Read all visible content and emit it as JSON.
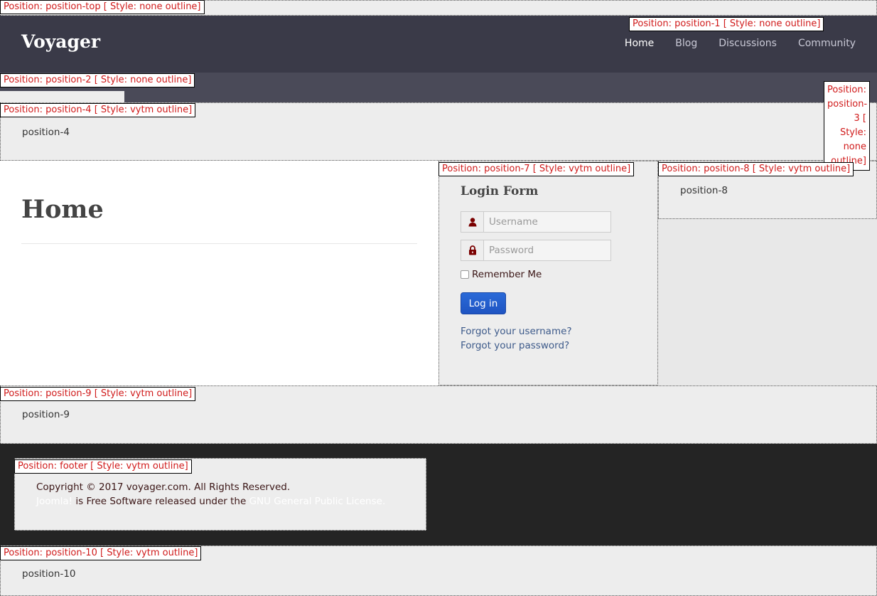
{
  "position_tags": {
    "top": "Position: position-top [ Style: none outline]",
    "p1": "Position: position-1 [ Style: none outline]",
    "p2": "Position: position-2 [ Style: none outline]",
    "p3": "Position: position-3 [ Style: none outline]",
    "p4": "Position: position-4 [ Style: vytm outline]",
    "p7": "Position: position-7 [ Style: vytm outline]",
    "p8": "Position: position-8 [ Style: vytm outline]",
    "p9": "Position: position-9 [ Style: vytm outline]",
    "footer": "Position: footer [ Style: vytm outline]",
    "p10": "Position: position-10 [ Style: vytm outline]"
  },
  "header": {
    "brand": "Voyager",
    "nav": [
      {
        "label": "Home",
        "active": true
      },
      {
        "label": "Blog"
      },
      {
        "label": "Discussions"
      },
      {
        "label": "Community"
      }
    ]
  },
  "module_text": {
    "p4": "position-4",
    "p8": "position-8",
    "p9": "position-9",
    "p10": "position-10"
  },
  "main": {
    "title": "Home"
  },
  "login": {
    "title": "Login Form",
    "username_placeholder": "Username",
    "password_placeholder": "Password",
    "remember_label": "Remember Me",
    "button_label": "Log in",
    "forgot_username": "Forgot your username?",
    "forgot_password": "Forgot your password?"
  },
  "footer": {
    "copyright": "Copyright © 2017 voyager.com. All Rights Reserved.",
    "joomla_link": "Joomla!",
    "middle_text": " is Free Software released under the ",
    "gpl_link": "GNU General Public License."
  },
  "colors": {
    "header_bg": "#3a3a48",
    "tag_text": "#d01a1a",
    "footer_bg": "#242424",
    "button": "#1f54c2"
  },
  "icons": {
    "username": "user-icon",
    "password": "lock-icon"
  }
}
